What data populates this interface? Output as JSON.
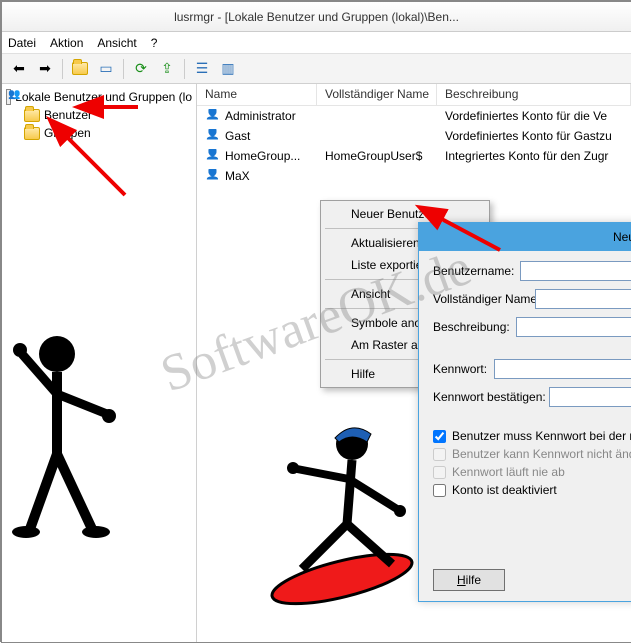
{
  "window": {
    "title": "lusrmgr - [Lokale Benutzer und Gruppen (lokal)\\Ben..."
  },
  "menu": {
    "file": "Datei",
    "action": "Aktion",
    "view": "Ansicht",
    "help": "?"
  },
  "toolbar_icons": [
    "back",
    "forward",
    "up",
    "show-hide",
    "refresh",
    "export",
    "properties",
    "help-pane"
  ],
  "tree": {
    "root": "Lokale Benutzer und Gruppen (lo",
    "items": [
      {
        "label": "Benutzer"
      },
      {
        "label": "Gruppen"
      }
    ]
  },
  "list": {
    "columns": {
      "name": "Name",
      "full": "Vollständiger Name",
      "desc": "Beschreibung"
    },
    "rows": [
      {
        "name": "Administrator",
        "full": "",
        "desc": "Vordefiniertes Konto für die Ve"
      },
      {
        "name": "Gast",
        "full": "",
        "desc": "Vordefiniertes Konto für Gastzu"
      },
      {
        "name": "HomeGroup...",
        "full": "HomeGroupUser$",
        "desc": "Integriertes Konto für den Zugr"
      },
      {
        "name": "MaX",
        "full": "",
        "desc": ""
      }
    ]
  },
  "context_menu": {
    "new_user": "Neuer Benutzer...",
    "refresh": "Aktualisieren",
    "export": "Liste exportieren...",
    "view": "Ansicht",
    "arrange": "Symbole anordnen",
    "align": "Am Raster ausrichten",
    "help": "Hilfe"
  },
  "dialog": {
    "title": "Neuer B",
    "username_label": "Benutzername:",
    "fullname_label": "Vollständiger Name:",
    "desc_label": "Beschreibung:",
    "password_label": "Kennwort:",
    "confirm_label": "Kennwort bestätigen:",
    "chk_must_change": "Benutzer muss Kennwort bei der n",
    "chk_cannot_change": "Benutzer kann Kennwort nicht änd",
    "chk_never_expires": "Kennwort läuft nie ab",
    "chk_disabled": "Konto ist deaktiviert",
    "help_btn": "Hilfe",
    "values": {
      "username": "",
      "fullname": "",
      "desc": "",
      "password": "",
      "confirm": ""
    }
  },
  "watermark": "SoftwareOK.de"
}
